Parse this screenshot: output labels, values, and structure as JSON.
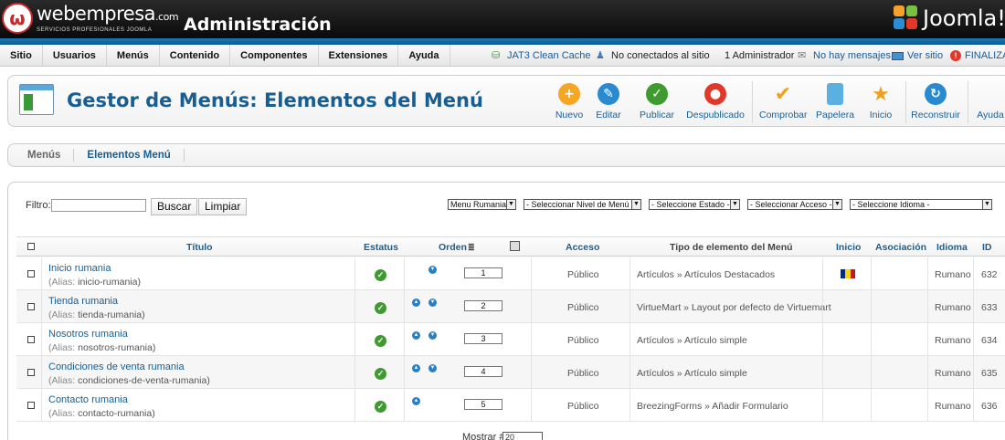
{
  "header": {
    "logo_main": "webempresa",
    "logo_suffix": ".com",
    "logo_sub": "SERVICIOS PROFESIONALES JOOMLA",
    "title": "Administración",
    "joomla_text": "Joomla!"
  },
  "menubar": {
    "items": [
      "Sitio",
      "Usuarios",
      "Menús",
      "Contenido",
      "Componentes",
      "Extensiones",
      "Ayuda"
    ],
    "cache": "JAT3 Clean Cache",
    "not_connected": "No conectados al sitio",
    "admins": "1 Administrador",
    "messages": "No hay mensajes",
    "view_site": "Ver sitio",
    "logout": "FINALIZAR"
  },
  "toolbar": {
    "page_title": "Gestor de Menús: Elementos del Menú",
    "buttons": {
      "new": "Nuevo",
      "edit": "Editar",
      "publish": "Publicar",
      "unpublish": "Despublicado",
      "checkin": "Comprobar",
      "trash": "Papelera",
      "home": "Inicio",
      "rebuild": "Reconstruir",
      "help": "Ayuda"
    }
  },
  "subtabs": [
    "Menús",
    "Elementos Menú"
  ],
  "filters": {
    "label": "Filtro:",
    "search_button": "Buscar",
    "clear_button": "Limpiar",
    "menu_select": "Menu Rumania",
    "level_select": "- Seleccionar Nivel de Menú -",
    "state_select": "- Seleccione Estado -",
    "access_select": "- Seleccionar Acceso -",
    "language_select": "- Seleccione Idioma -"
  },
  "table": {
    "columns": {
      "title": "Título",
      "status": "Estatus",
      "order": "Orden",
      "access": "Acceso",
      "type": "Tipo de elemento del Menú",
      "home": "Inicio",
      "association": "Asociación",
      "language": "Idioma",
      "id": "ID"
    },
    "alias_prefix": "(Alias:",
    "rows": [
      {
        "title": "Inicio rumania",
        "alias": "inicio-rumania)",
        "order": "1",
        "access": "Público",
        "type": "Artículos » Artículos Destacados",
        "language": "Rumano",
        "id": "632"
      },
      {
        "title": "Tienda rumania",
        "alias": "tienda-rumania)",
        "order": "2",
        "access": "Público",
        "type": "VirtueMart » Layout por defecto de Virtuemart",
        "language": "Rumano",
        "id": "633"
      },
      {
        "title": "Nosotros rumania",
        "alias": "nosotros-rumania)",
        "order": "3",
        "access": "Público",
        "type": "Artículos » Artículo simple",
        "language": "Rumano",
        "id": "634"
      },
      {
        "title": "Condiciones de venta rumania",
        "alias": "condiciones-de-venta-rumania)",
        "order": "4",
        "access": "Público",
        "type": "Artículos » Artículo simple",
        "language": "Rumano",
        "id": "635"
      },
      {
        "title": "Contacto rumania",
        "alias": "contacto-rumania)",
        "order": "5",
        "access": "Público",
        "type": "BreezingForms » Añadir Formulario",
        "language": "Rumano",
        "id": "636"
      }
    ]
  },
  "footer": {
    "show_label": "Mostrar #",
    "show_value": "20"
  },
  "colors": {
    "link": "#195e92",
    "published": "#3f9a2f",
    "new": "#f5a623",
    "edit": "#2a8ad0",
    "unpublish": "#e2382a"
  }
}
